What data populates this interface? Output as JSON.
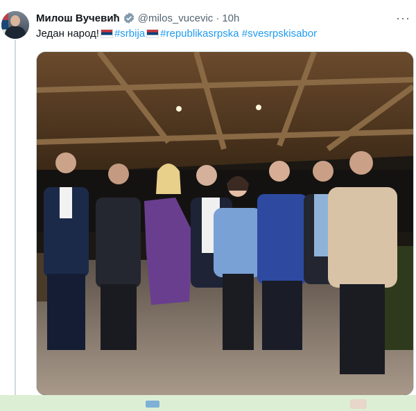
{
  "tweet": {
    "author_name": "Милош Вучевић",
    "handle": "@milos_vucevic",
    "separator": "·",
    "time": "10h",
    "more": "···",
    "text_lead": "Један народ!",
    "hashtags": [
      "#srbija",
      "#republikasrpska",
      "#svesrpskisabor"
    ],
    "flag_icon": "serbian-flag-emoji",
    "verified_icon": "verified-badge-icon",
    "colors": {
      "link": "#1d9bf0",
      "name": "#0f1419",
      "muted": "#536471",
      "verified": "#829aab"
    }
  }
}
